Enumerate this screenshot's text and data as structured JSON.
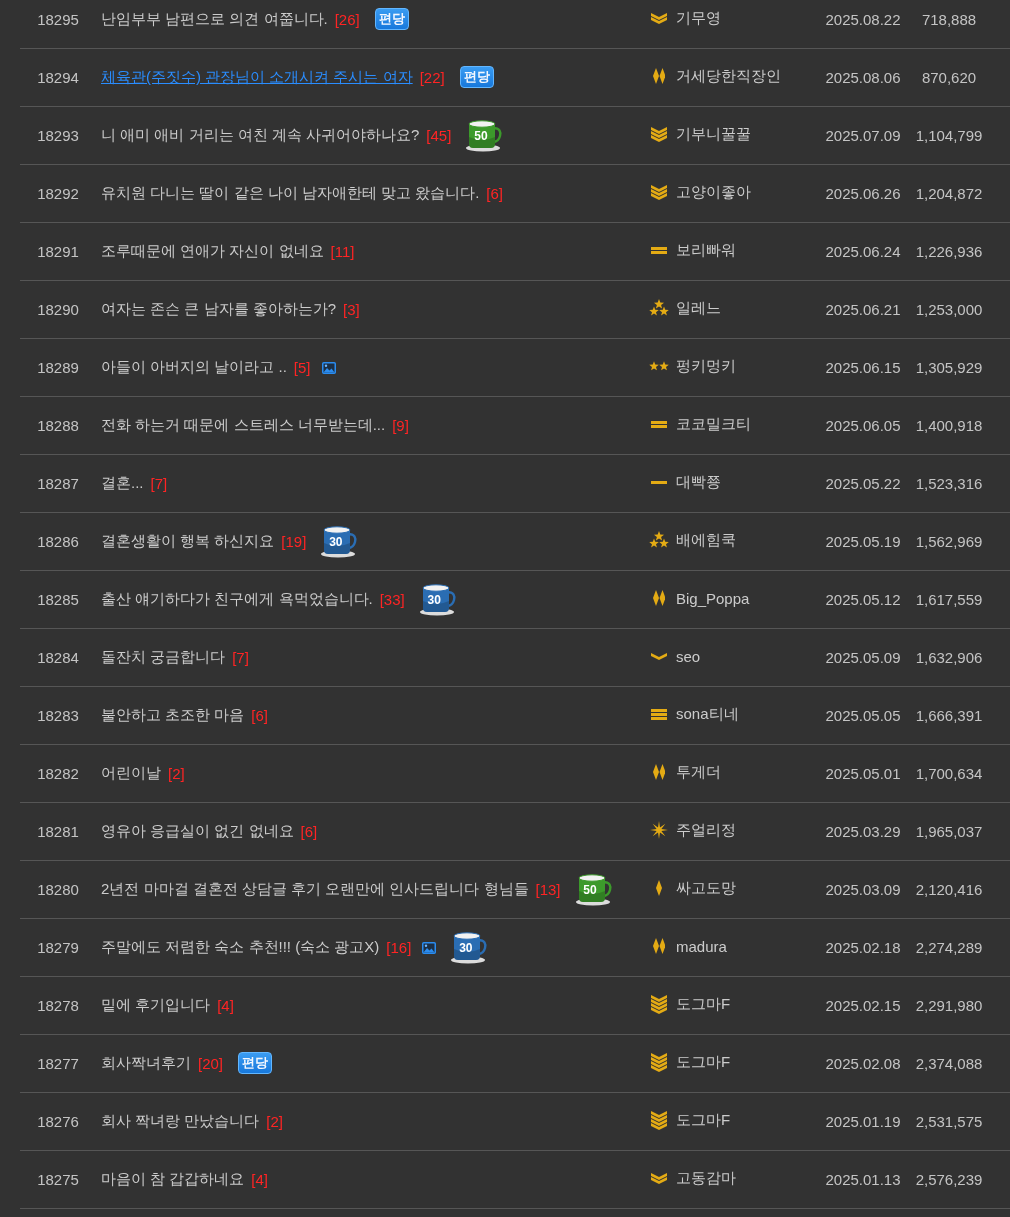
{
  "rows": [
    {
      "number": "18295",
      "title": "난임부부 남편으로 의견 여쭙니다.",
      "comments": "[26]",
      "hovered": false,
      "has_image": false,
      "badge": "편당",
      "writer": {
        "rank": {
          "kind": "chevron2"
        },
        "name": "기무영"
      },
      "date": "2025.08.22",
      "views": "718,888"
    },
    {
      "number": "18294",
      "title": "체육관(주짓수) 관장님이 소개시켜 주시는 여자",
      "comments": "[22]",
      "hovered": true,
      "has_image": false,
      "badge": "편당",
      "writer": {
        "rank": {
          "kind": "diamond2"
        },
        "name": "거세당한직장인"
      },
      "date": "2025.08.06",
      "views": "870,620"
    },
    {
      "number": "18293",
      "title": "니 애미 애비 거리는 여친 계속 사귀어야하나요?",
      "comments": "[45]",
      "hovered": false,
      "has_image": false,
      "mug": {
        "label": "50",
        "color": "#3c9a2b"
      },
      "writer": {
        "rank": {
          "kind": "chevron3"
        },
        "name": "기부니꿀꿀"
      },
      "date": "2025.07.09",
      "views": "1,104,799"
    },
    {
      "number": "18292",
      "title": "유치원 다니는 딸이 같은 나이 남자애한테 맞고 왔습니다.",
      "comments": "[6]",
      "hovered": false,
      "has_image": false,
      "writer": {
        "rank": {
          "kind": "chevron3"
        },
        "name": "고양이좋아"
      },
      "date": "2025.06.26",
      "views": "1,204,872"
    },
    {
      "number": "18291",
      "title": "조루때문에 연애가 자신이 없네요",
      "comments": "[11]",
      "hovered": false,
      "has_image": false,
      "writer": {
        "rank": {
          "kind": "bar2"
        },
        "name": "보리빠워"
      },
      "date": "2025.06.24",
      "views": "1,226,936"
    },
    {
      "number": "18290",
      "title": "여자는 존슨 큰 남자를 좋아하는가?",
      "comments": "[3]",
      "hovered": false,
      "has_image": false,
      "writer": {
        "rank": {
          "kind": "cluster"
        },
        "name": "일레느"
      },
      "date": "2025.06.21",
      "views": "1,253,000"
    },
    {
      "number": "18289",
      "title": "아들이 아버지의 날이라고 ..",
      "comments": "[5]",
      "hovered": false,
      "has_image": true,
      "writer": {
        "rank": {
          "kind": "star2"
        },
        "name": "펑키멍키"
      },
      "date": "2025.06.15",
      "views": "1,305,929"
    },
    {
      "number": "18288",
      "title": "전화 하는거 때문에 스트레스 너무받는데...",
      "comments": "[9]",
      "hovered": false,
      "has_image": false,
      "writer": {
        "rank": {
          "kind": "bar2"
        },
        "name": "코코밀크티"
      },
      "date": "2025.06.05",
      "views": "1,400,918"
    },
    {
      "number": "18287",
      "title": "결혼...",
      "comments": "[7]",
      "hovered": false,
      "has_image": false,
      "writer": {
        "rank": {
          "kind": "bar1"
        },
        "name": "대빡쭁"
      },
      "date": "2025.05.22",
      "views": "1,523,316"
    },
    {
      "number": "18286",
      "title": "결혼생활이 행복 하신지요",
      "comments": "[19]",
      "hovered": false,
      "has_image": false,
      "mug": {
        "label": "30",
        "color": "#2a6db3"
      },
      "writer": {
        "rank": {
          "kind": "cluster"
        },
        "name": "배에힘쿡"
      },
      "date": "2025.05.19",
      "views": "1,562,969"
    },
    {
      "number": "18285",
      "title": "출산 얘기하다가 친구에게 욕먹었습니다.",
      "comments": "[33]",
      "hovered": false,
      "has_image": false,
      "mug": {
        "label": "30",
        "color": "#2a6db3"
      },
      "writer": {
        "rank": {
          "kind": "diamond2"
        },
        "name": "Big_Poppa"
      },
      "date": "2025.05.12",
      "views": "1,617,559"
    },
    {
      "number": "18284",
      "title": "돌잔치 궁금합니다",
      "comments": "[7]",
      "hovered": false,
      "has_image": false,
      "writer": {
        "rank": {
          "kind": "chevron1"
        },
        "name": "seo"
      },
      "date": "2025.05.09",
      "views": "1,632,906"
    },
    {
      "number": "18283",
      "title": "불안하고 초조한 마음",
      "comments": "[6]",
      "hovered": false,
      "has_image": false,
      "writer": {
        "rank": {
          "kind": "bar3"
        },
        "name": "sona티네"
      },
      "date": "2025.05.05",
      "views": "1,666,391"
    },
    {
      "number": "18282",
      "title": "어린이날",
      "comments": "[2]",
      "hovered": false,
      "has_image": false,
      "writer": {
        "rank": {
          "kind": "diamond2"
        },
        "name": "투게더"
      },
      "date": "2025.05.01",
      "views": "1,700,634"
    },
    {
      "number": "18281",
      "title": "영유아 응급실이 없긴 없네요",
      "comments": "[6]",
      "hovered": false,
      "has_image": false,
      "writer": {
        "rank": {
          "kind": "sparkle"
        },
        "name": "주얼리정"
      },
      "date": "2025.03.29",
      "views": "1,965,037"
    },
    {
      "number": "18280",
      "title": "2년전 마마걸 결혼전 상담글 후기 오랜만에 인사드립니다 형님들",
      "comments": "[13]",
      "hovered": false,
      "has_image": false,
      "mug": {
        "label": "50",
        "color": "#3c9a2b"
      },
      "writer": {
        "rank": {
          "kind": "diamond1"
        },
        "name": "싸고도망"
      },
      "date": "2025.03.09",
      "views": "2,120,416"
    },
    {
      "number": "18279",
      "title": "주말에도 저렴한 숙소 추천!!! (숙소 광고X)",
      "comments": "[16]",
      "hovered": false,
      "has_image": true,
      "mug": {
        "label": "30",
        "color": "#2a6db3"
      },
      "writer": {
        "rank": {
          "kind": "diamond2"
        },
        "name": "madura"
      },
      "date": "2025.02.18",
      "views": "2,274,289"
    },
    {
      "number": "18278",
      "title": "밑에 후기입니다",
      "comments": "[4]",
      "hovered": false,
      "has_image": false,
      "writer": {
        "rank": {
          "kind": "chevron4"
        },
        "name": "도그마F"
      },
      "date": "2025.02.15",
      "views": "2,291,980"
    },
    {
      "number": "18277",
      "title": "회사짝녀후기",
      "comments": "[20]",
      "hovered": false,
      "has_image": false,
      "badge": "편당",
      "writer": {
        "rank": {
          "kind": "chevron4"
        },
        "name": "도그마F"
      },
      "date": "2025.02.08",
      "views": "2,374,088"
    },
    {
      "number": "18276",
      "title": "회사 짝녀랑 만났습니다",
      "comments": "[2]",
      "hovered": false,
      "has_image": false,
      "writer": {
        "rank": {
          "kind": "chevron4"
        },
        "name": "도그마F"
      },
      "date": "2025.01.19",
      "views": "2,531,575"
    },
    {
      "number": "18275",
      "title": "마음이 참 갑갑하네요",
      "comments": "[4]",
      "hovered": false,
      "has_image": false,
      "writer": {
        "rank": {
          "kind": "chevron2"
        },
        "name": "고동감마"
      },
      "date": "2025.01.13",
      "views": "2,576,239"
    }
  ]
}
